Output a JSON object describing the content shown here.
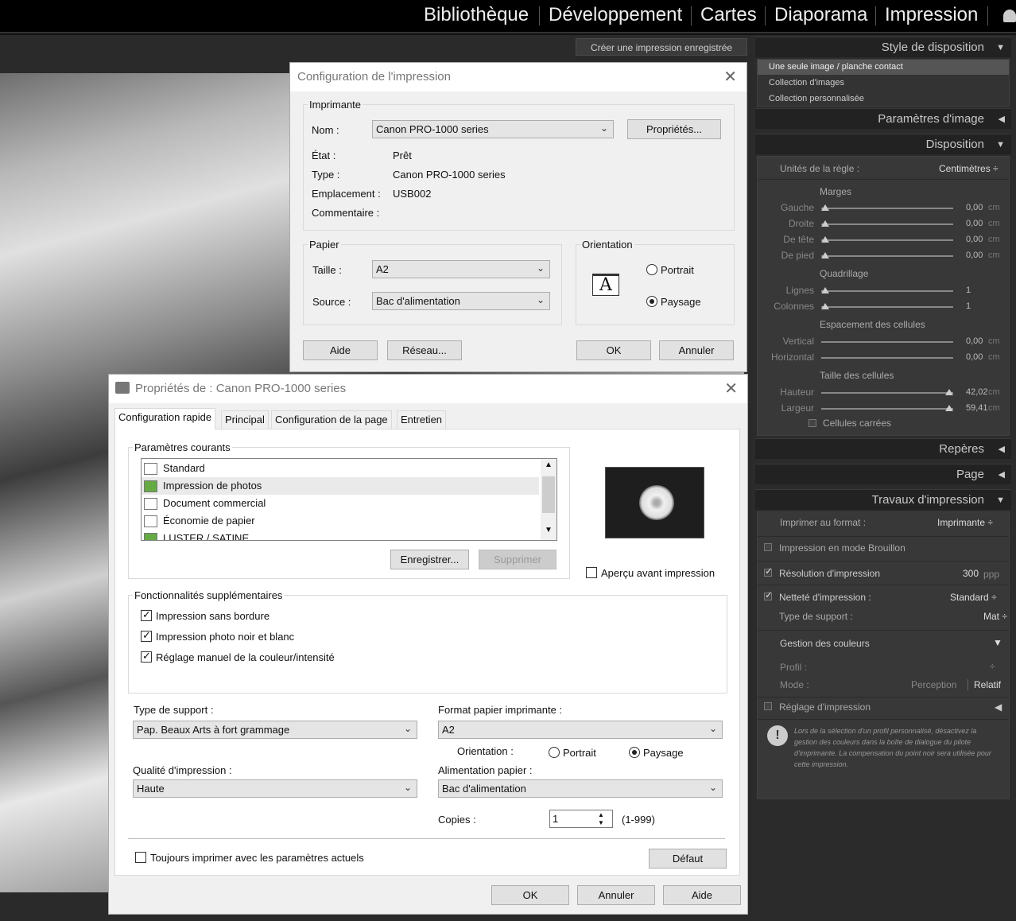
{
  "modules": [
    "Bibliothèque",
    "Développement",
    "Cartes",
    "Diaporama",
    "Impression"
  ],
  "save_print": "Créer une impression enregistrée",
  "right": {
    "layout_style": "Style de disposition",
    "layout_items": [
      "Une seule image / planche contact",
      "Collection d'images",
      "Collection personnalisée"
    ],
    "image_settings": "Paramètres d'image",
    "disposition": "Disposition",
    "ruler_units_label": "Unités de la règle :",
    "ruler_units_value": "Centimètres ÷",
    "margins": "Marges",
    "margin_rows": [
      {
        "l": "Gauche",
        "v": "0,00",
        "u": "cm"
      },
      {
        "l": "Droite",
        "v": "0,00",
        "u": "cm"
      },
      {
        "l": "De tête",
        "v": "0,00",
        "u": "cm"
      },
      {
        "l": "De pied",
        "v": "0,00",
        "u": "cm"
      }
    ],
    "grid": "Quadrillage",
    "grid_rows": [
      {
        "l": "Lignes",
        "v": "1"
      },
      {
        "l": "Colonnes",
        "v": "1"
      }
    ],
    "spacing": "Espacement des cellules",
    "spacing_rows": [
      {
        "l": "Vertical",
        "v": "0,00",
        "u": "cm"
      },
      {
        "l": "Horizontal",
        "v": "0,00",
        "u": "cm"
      }
    ],
    "cell_size": "Taille des cellules",
    "cell_rows": [
      {
        "l": "Hauteur",
        "v": "42,02",
        "u": "cm"
      },
      {
        "l": "Largeur",
        "v": "59,41",
        "u": "cm"
      }
    ],
    "square_cells": "Cellules carrées",
    "guides": "Repères",
    "page": "Page",
    "print_job": "Travaux d'impression",
    "print_to_label": "Imprimer au format :",
    "print_to_value": "Imprimante ÷",
    "draft_mode": "Impression en mode Brouillon",
    "print_res": "Résolution d'impression",
    "print_res_value": "300",
    "print_res_unit": "ppp",
    "sharpen": "Netteté d'impression :",
    "sharpen_value": "Standard ÷",
    "media_type": "Type de support :",
    "media_value": "Mat ÷",
    "color_mgmt": "Gestion des couleurs",
    "profile": "Profil :",
    "profile_value": "÷",
    "mode": "Mode :",
    "mode_perception": "Perception",
    "mode_relatif": "Relatif",
    "print_adjust": "Réglage d'impression",
    "notice": "Lors de la sélection d'un profil personnalisé, désactivez la gestion des couleurs dans la boîte de dialogue du pilote d'imprimante. La compensation du point noir sera utilisée pour cette impression."
  },
  "config": {
    "title": "Configuration de l'impression",
    "printer_group": "Imprimante",
    "name_label": "Nom :",
    "name_value": "Canon PRO-1000 series",
    "properties_btn": "Propriétés...",
    "state_label": "État :",
    "state_value": "Prêt",
    "type_label": "Type :",
    "type_value": "Canon PRO-1000 series",
    "location_label": "Emplacement :",
    "location_value": "USB002",
    "comment_label": "Commentaire :",
    "paper_group": "Papier",
    "size_label": "Taille :",
    "size_value": "A2",
    "source_label": "Source :",
    "source_value": "Bac d'alimentation",
    "orientation_group": "Orientation",
    "portrait": "Portrait",
    "landscape": "Paysage",
    "help_btn": "Aide",
    "network_btn": "Réseau...",
    "ok_btn": "OK",
    "cancel_btn": "Annuler"
  },
  "props": {
    "title": "Propriétés de : Canon PRO-1000 series",
    "tabs": [
      "Configuration rapide",
      "Principal",
      "Configuration de la page",
      "Entretien"
    ],
    "current_settings": "Paramètres courants",
    "list": [
      "Standard",
      "Impression de photos",
      "Document commercial",
      "Économie de papier",
      "LUSTER / SATINE"
    ],
    "save_btn": "Enregistrer...",
    "delete_btn": "Supprimer",
    "preview_chk": "Aperçu avant impression",
    "extra_group": "Fonctionnalités supplémentaires",
    "extras": [
      "Impression sans bordure",
      "Impression photo noir et blanc",
      "Réglage manuel de la couleur/intensité"
    ],
    "media_label": "Type de support :",
    "media_value": "Pap. Beaux Arts à fort grammage",
    "paper_fmt_label": "Format papier imprimante :",
    "paper_fmt_value": "A2",
    "orientation_label": "Orientation :",
    "portrait": "Portrait",
    "landscape": "Paysage",
    "quality_label": "Qualité d'impression :",
    "quality_value": "Haute",
    "feed_label": "Alimentation papier :",
    "feed_value": "Bac d'alimentation",
    "copies_label": "Copies :",
    "copies_value": "1",
    "copies_range": "(1-999)",
    "always_print": "Toujours imprimer avec les paramètres actuels",
    "default_btn": "Défaut",
    "ok_btn": "OK",
    "cancel_btn": "Annuler",
    "help_btn": "Aide"
  }
}
